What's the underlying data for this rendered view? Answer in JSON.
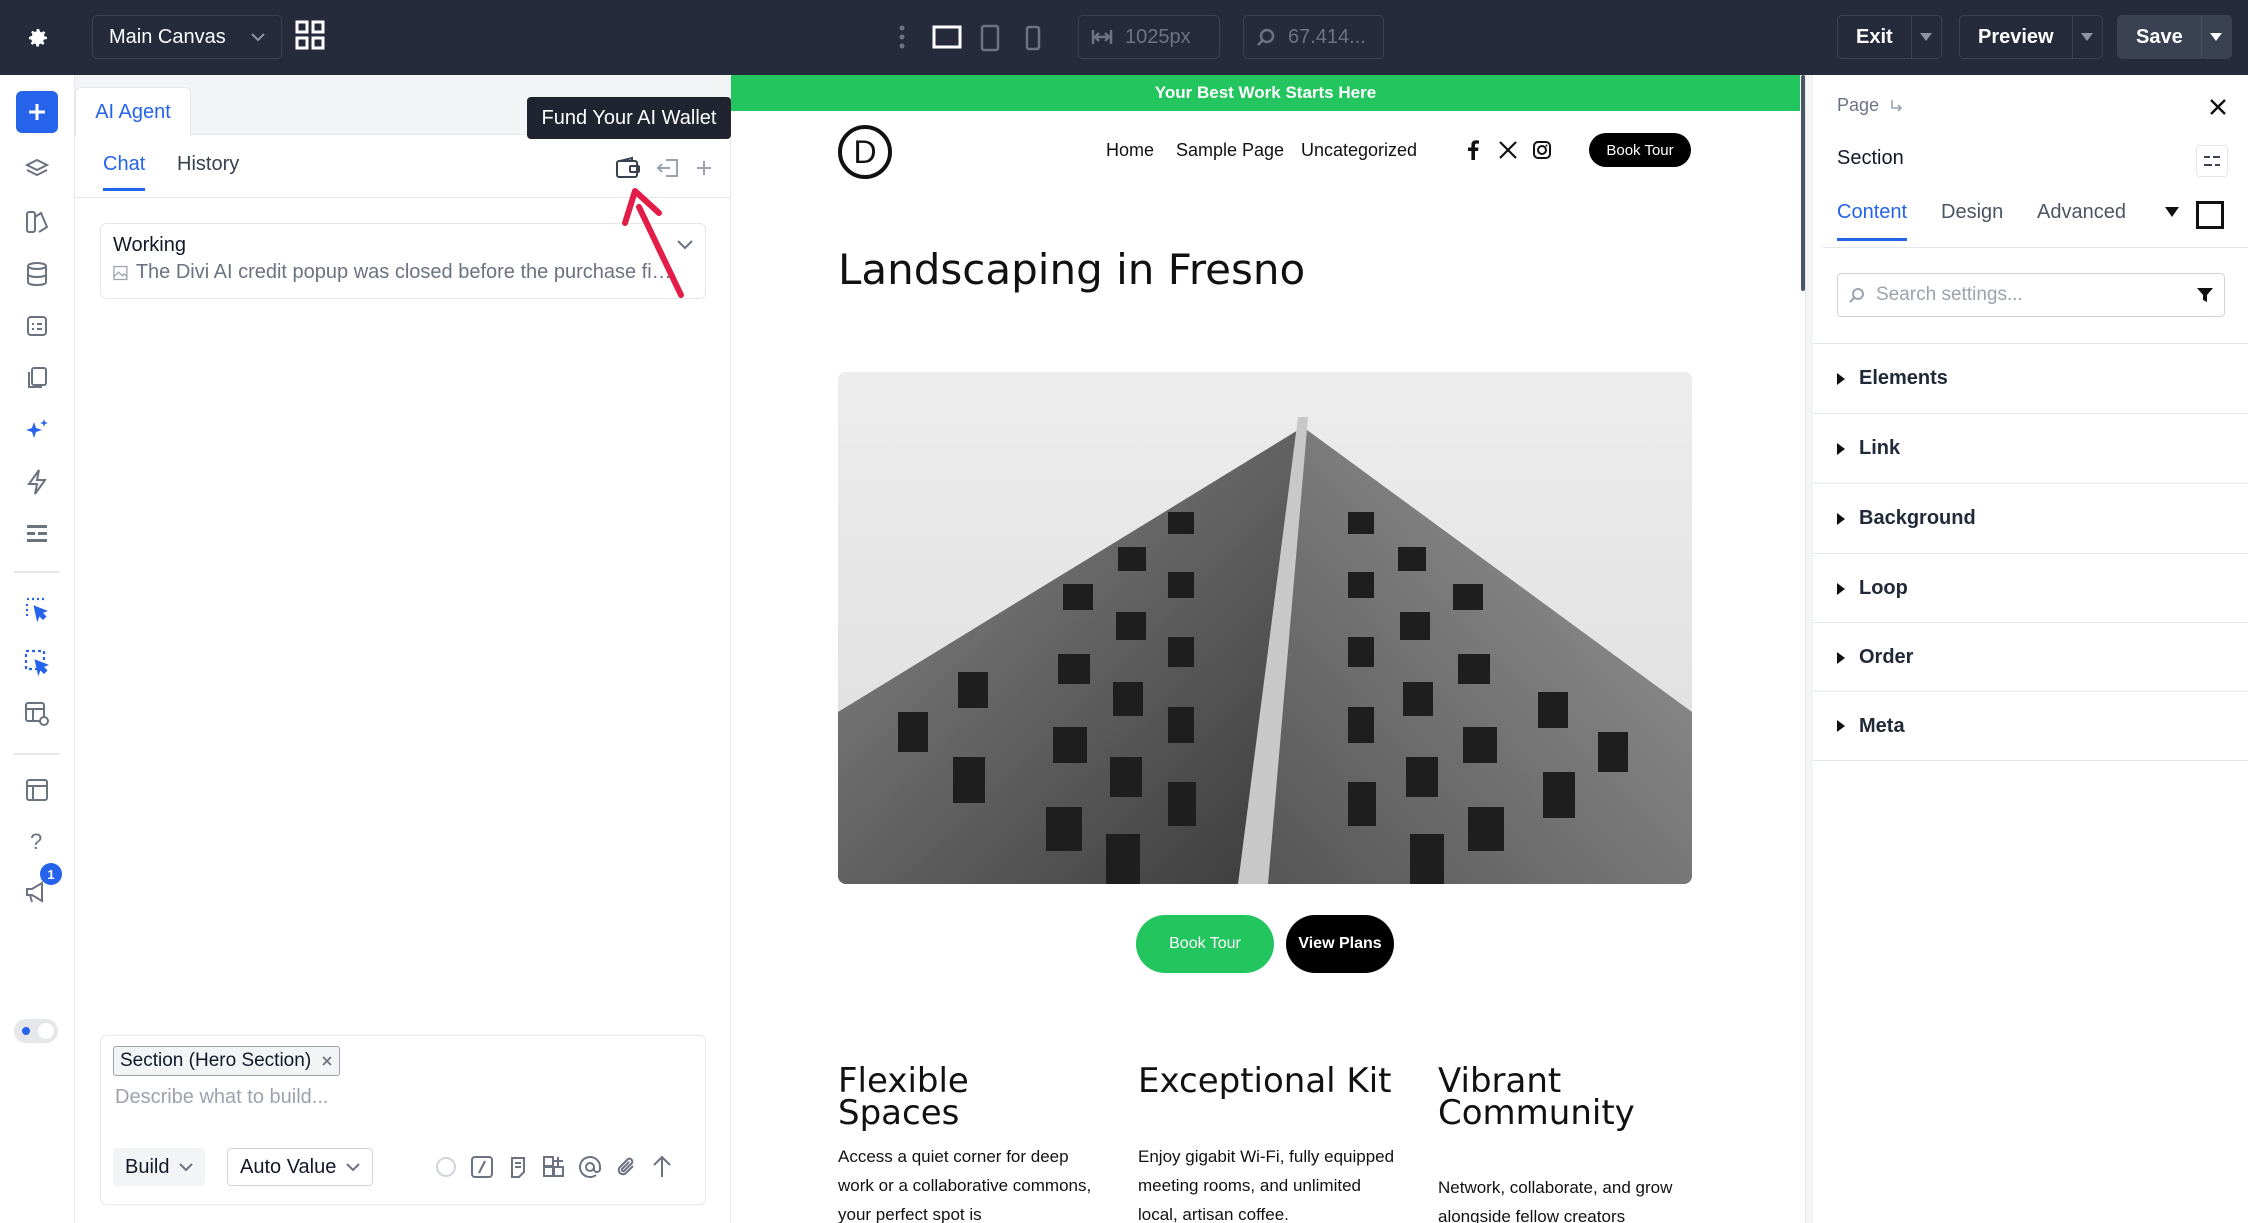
{
  "topbar": {
    "canvas_label": "Main Canvas",
    "width_value": "1025px",
    "zoom_value": "67.414...",
    "exit_label": "Exit",
    "preview_label": "Preview",
    "save_label": "Save"
  },
  "rail": {
    "notification_count": "1"
  },
  "ai_panel": {
    "tab_label": "AI Agent",
    "tooltip": "Fund Your AI Wallet",
    "subtabs": [
      "Chat",
      "History"
    ],
    "working_title": "Working",
    "working_message": "The Divi AI credit popup was closed before the purchase finished.",
    "chip_label": "Section (Hero Section)",
    "composer_placeholder": "Describe what to build...",
    "mode_label": "Build",
    "value_label": "Auto Value"
  },
  "preview": {
    "banner": "Your Best Work Starts Here",
    "logo_letter": "D",
    "nav": [
      "Home",
      "Sample Page",
      "Uncategorized"
    ],
    "book_tour_pill": "Book Tour",
    "hero_title": "Landscaping in Fresno",
    "btn_primary": "Book Tour",
    "btn_secondary": "View Plans",
    "features": [
      {
        "title": "Flexible Spaces",
        "text": "Access a quiet corner for deep work or a collaborative commons, your perfect spot is"
      },
      {
        "title": "Exceptional Kit",
        "text": "Enjoy gigabit Wi-Fi, fully equipped meeting rooms, and unlimited local, artisan coffee."
      },
      {
        "title": "Vibrant Community",
        "text": "Network, collaborate, and grow alongside fellow creators"
      }
    ],
    "colors": {
      "banner": "#22c55e",
      "accent": "#2563eb"
    }
  },
  "settings": {
    "breadcrumb": "Page",
    "title": "Section",
    "tabs": [
      "Content",
      "Design",
      "Advanced"
    ],
    "search_placeholder": "Search settings...",
    "groups": [
      "Elements",
      "Link",
      "Background",
      "Loop",
      "Order",
      "Meta"
    ]
  }
}
